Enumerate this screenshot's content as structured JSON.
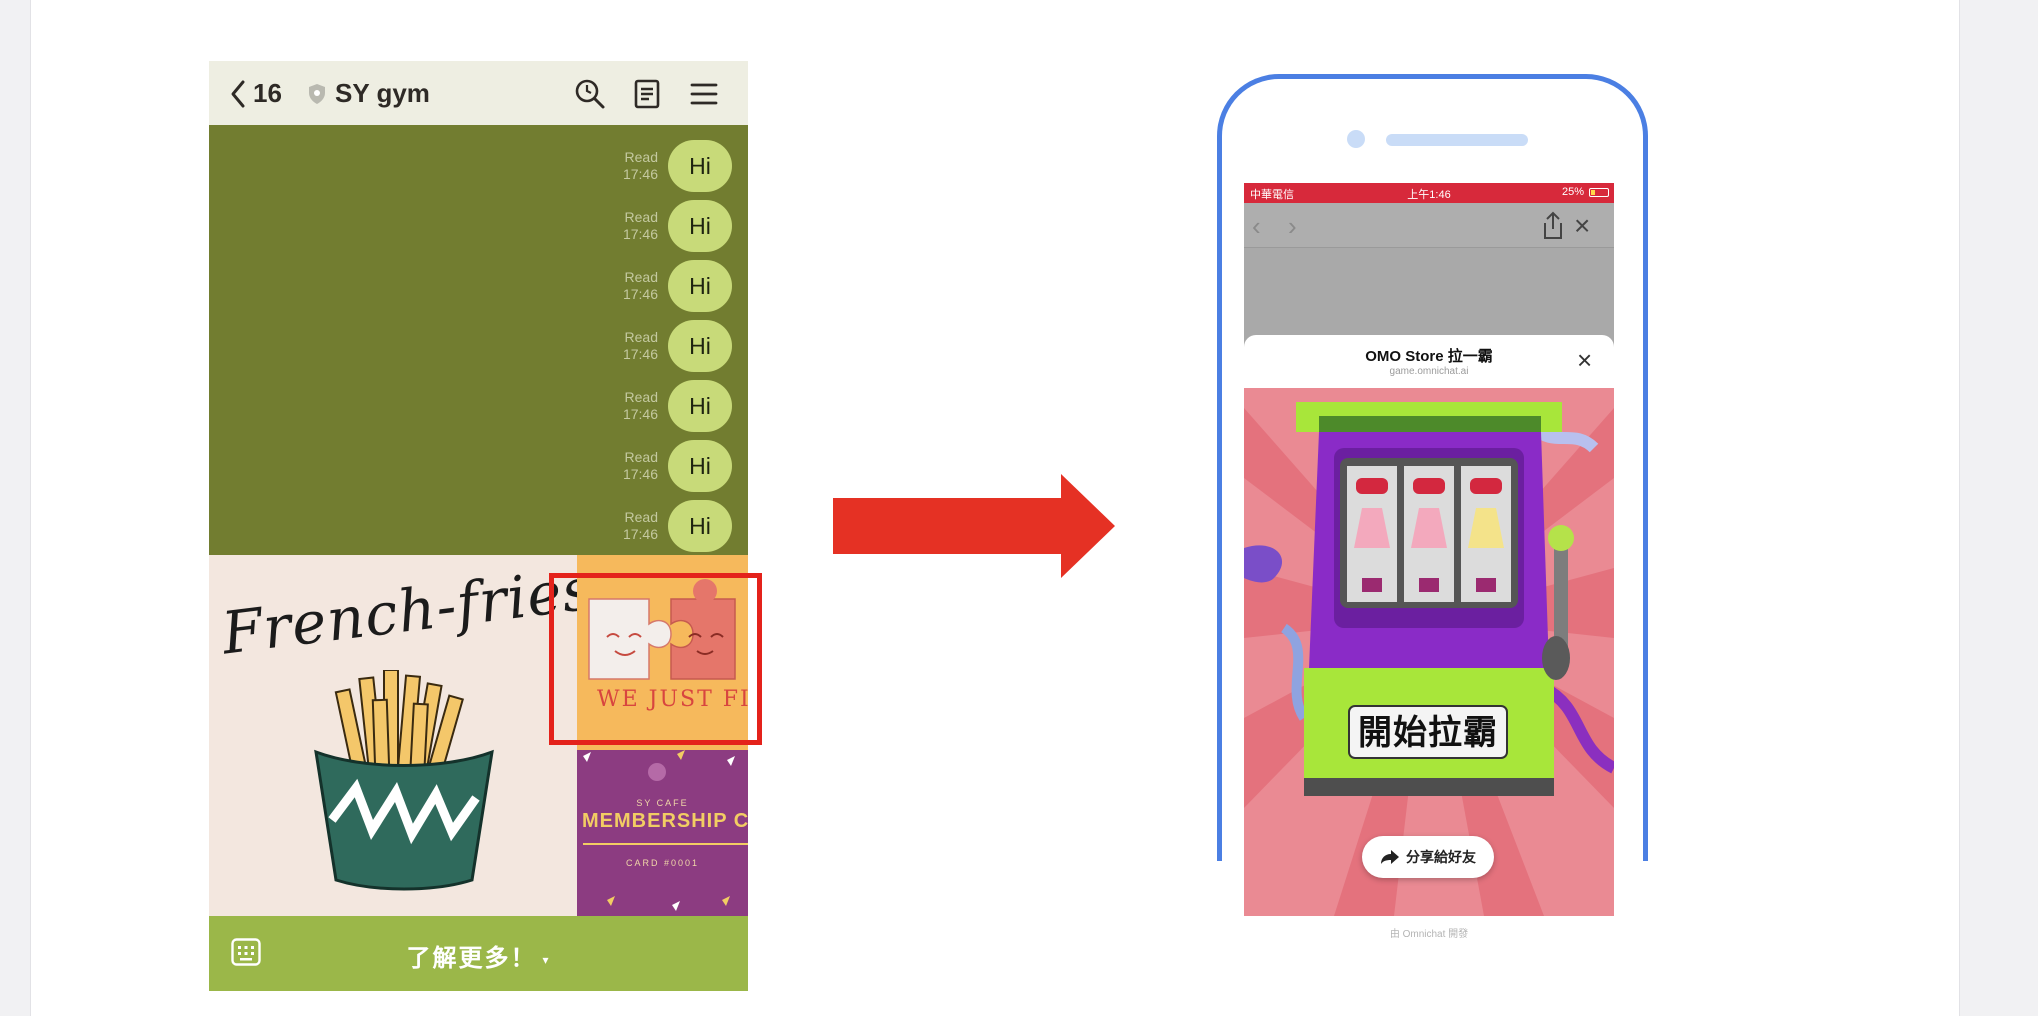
{
  "chat": {
    "header": {
      "back_count": "16",
      "room_name": "SY gym"
    },
    "messages": [
      {
        "status": "Read",
        "time": "17:46",
        "text": "Hi"
      },
      {
        "status": "Read",
        "time": "17:46",
        "text": "Hi"
      },
      {
        "status": "Read",
        "time": "17:46",
        "text": "Hi"
      },
      {
        "status": "Read",
        "time": "17:46",
        "text": "Hi"
      },
      {
        "status": "Read",
        "time": "17:46",
        "text": "Hi"
      },
      {
        "status": "Read",
        "time": "17:46",
        "text": "Hi"
      },
      {
        "status": "Read",
        "time": "17:46",
        "text": "Hi"
      }
    ],
    "rich_menu": {
      "fries_title": "French-fries",
      "fit_text": "WE JUST FIT.",
      "card_brand": "SY CAFE",
      "card_title": "MEMBERSHIP CARD",
      "card_number": "CARD #0001"
    },
    "footer": {
      "label": "了解更多！",
      "caret": "▾"
    },
    "colors": {
      "chat_background": "#727d30",
      "bubble": "#c8da79",
      "footer": "#9bb749",
      "highlight": "#e4221b"
    }
  },
  "arrow": {
    "color": "#e53124"
  },
  "phone": {
    "status_bar": {
      "carrier": "中華電信",
      "time": "上午1:46",
      "battery": "25%"
    },
    "sheet": {
      "title": "OMO Store 拉一霸",
      "domain": "game.omnichat.ai"
    },
    "game": {
      "start_button": "開始拉霸",
      "share_button": "分享給好友"
    },
    "footer_credit": "由 Omnichat 開發",
    "colors": {
      "frame": "#4b7fe3",
      "status_bar": "#d7293b"
    }
  }
}
